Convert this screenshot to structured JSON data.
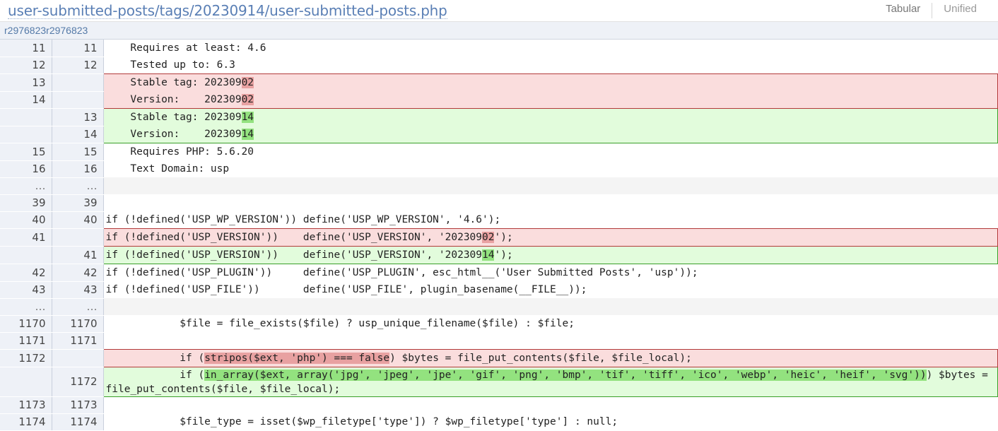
{
  "header": {
    "file_path": "user-submitted-posts/tags/20230914/user-submitted-posts.php",
    "view_tabular": "Tabular",
    "view_unified": "Unified"
  },
  "revisions": "r2976823r2976823",
  "rows": [
    {
      "type": "ctx",
      "old": "11",
      "new": "11",
      "code": "    Requires at least: 4.6"
    },
    {
      "type": "ctx",
      "old": "12",
      "new": "12",
      "code": "    Tested up to: 6.3"
    },
    {
      "type": "rem",
      "pos": "first",
      "old": "13",
      "new": "",
      "pre": "    Stable tag: 202309",
      "hl": "02",
      "post": ""
    },
    {
      "type": "rem",
      "pos": "last",
      "old": "14",
      "new": "",
      "pre": "    Version:    202309",
      "hl": "02",
      "post": ""
    },
    {
      "type": "add",
      "pos": "first",
      "old": "",
      "new": "13",
      "pre": "    Stable tag: 202309",
      "hl": "14",
      "post": ""
    },
    {
      "type": "add",
      "pos": "last",
      "old": "",
      "new": "14",
      "pre": "    Version:    202309",
      "hl": "14",
      "post": ""
    },
    {
      "type": "ctx",
      "old": "15",
      "new": "15",
      "code": "    Requires PHP: 5.6.20"
    },
    {
      "type": "ctx",
      "old": "16",
      "new": "16",
      "code": "    Text Domain: usp"
    },
    {
      "type": "skip",
      "old": "…",
      "new": "…",
      "code": ""
    },
    {
      "type": "ctx",
      "old": "39",
      "new": "39",
      "code": ""
    },
    {
      "type": "ctx",
      "old": "40",
      "new": "40",
      "code": "if (!defined('USP_WP_VERSION')) define('USP_WP_VERSION', '4.6');"
    },
    {
      "type": "rem",
      "pos": "first last",
      "old": "41",
      "new": "",
      "pre": "if (!defined('USP_VERSION'))    define('USP_VERSION', '202309",
      "hl": "02",
      "post": "');"
    },
    {
      "type": "add",
      "pos": "first last",
      "old": "",
      "new": "41",
      "pre": "if (!defined('USP_VERSION'))    define('USP_VERSION', '202309",
      "hl": "14",
      "post": "');"
    },
    {
      "type": "ctx",
      "old": "42",
      "new": "42",
      "code": "if (!defined('USP_PLUGIN'))     define('USP_PLUGIN', esc_html__('User Submitted Posts', 'usp'));"
    },
    {
      "type": "ctx",
      "old": "43",
      "new": "43",
      "code": "if (!defined('USP_FILE'))       define('USP_FILE', plugin_basename(__FILE__));"
    },
    {
      "type": "skip",
      "old": "…",
      "new": "…",
      "code": ""
    },
    {
      "type": "ctx",
      "old": "1170",
      "new": "1170",
      "code": "            $file = file_exists($file) ? usp_unique_filename($file) : $file;"
    },
    {
      "type": "ctx",
      "old": "1171",
      "new": "1171",
      "code": ""
    },
    {
      "type": "rem",
      "pos": "first last",
      "old": "1172",
      "new": "",
      "pre": "            if (",
      "hl": "stripos($ext, 'php') === false",
      "post": ") $bytes = file_put_contents($file, $file_local);"
    },
    {
      "type": "add",
      "pos": "first last",
      "wrap": true,
      "old": "",
      "new": "1172",
      "pre": "            if (",
      "hl": "in_array($ext, array('jpg', 'jpeg', 'jpe', 'gif', 'png', 'bmp', 'tif', 'tiff', 'ico', 'webp', 'heic', 'heif', 'svg'))",
      "post": ") $bytes = file_put_contents($file, $file_local);"
    },
    {
      "type": "ctx",
      "old": "1173",
      "new": "1173",
      "code": ""
    },
    {
      "type": "ctx",
      "old": "1174",
      "new": "1174",
      "code": "            $file_type = isset($wp_filetype['type']) ? $wp_filetype['type'] : null;"
    }
  ]
}
